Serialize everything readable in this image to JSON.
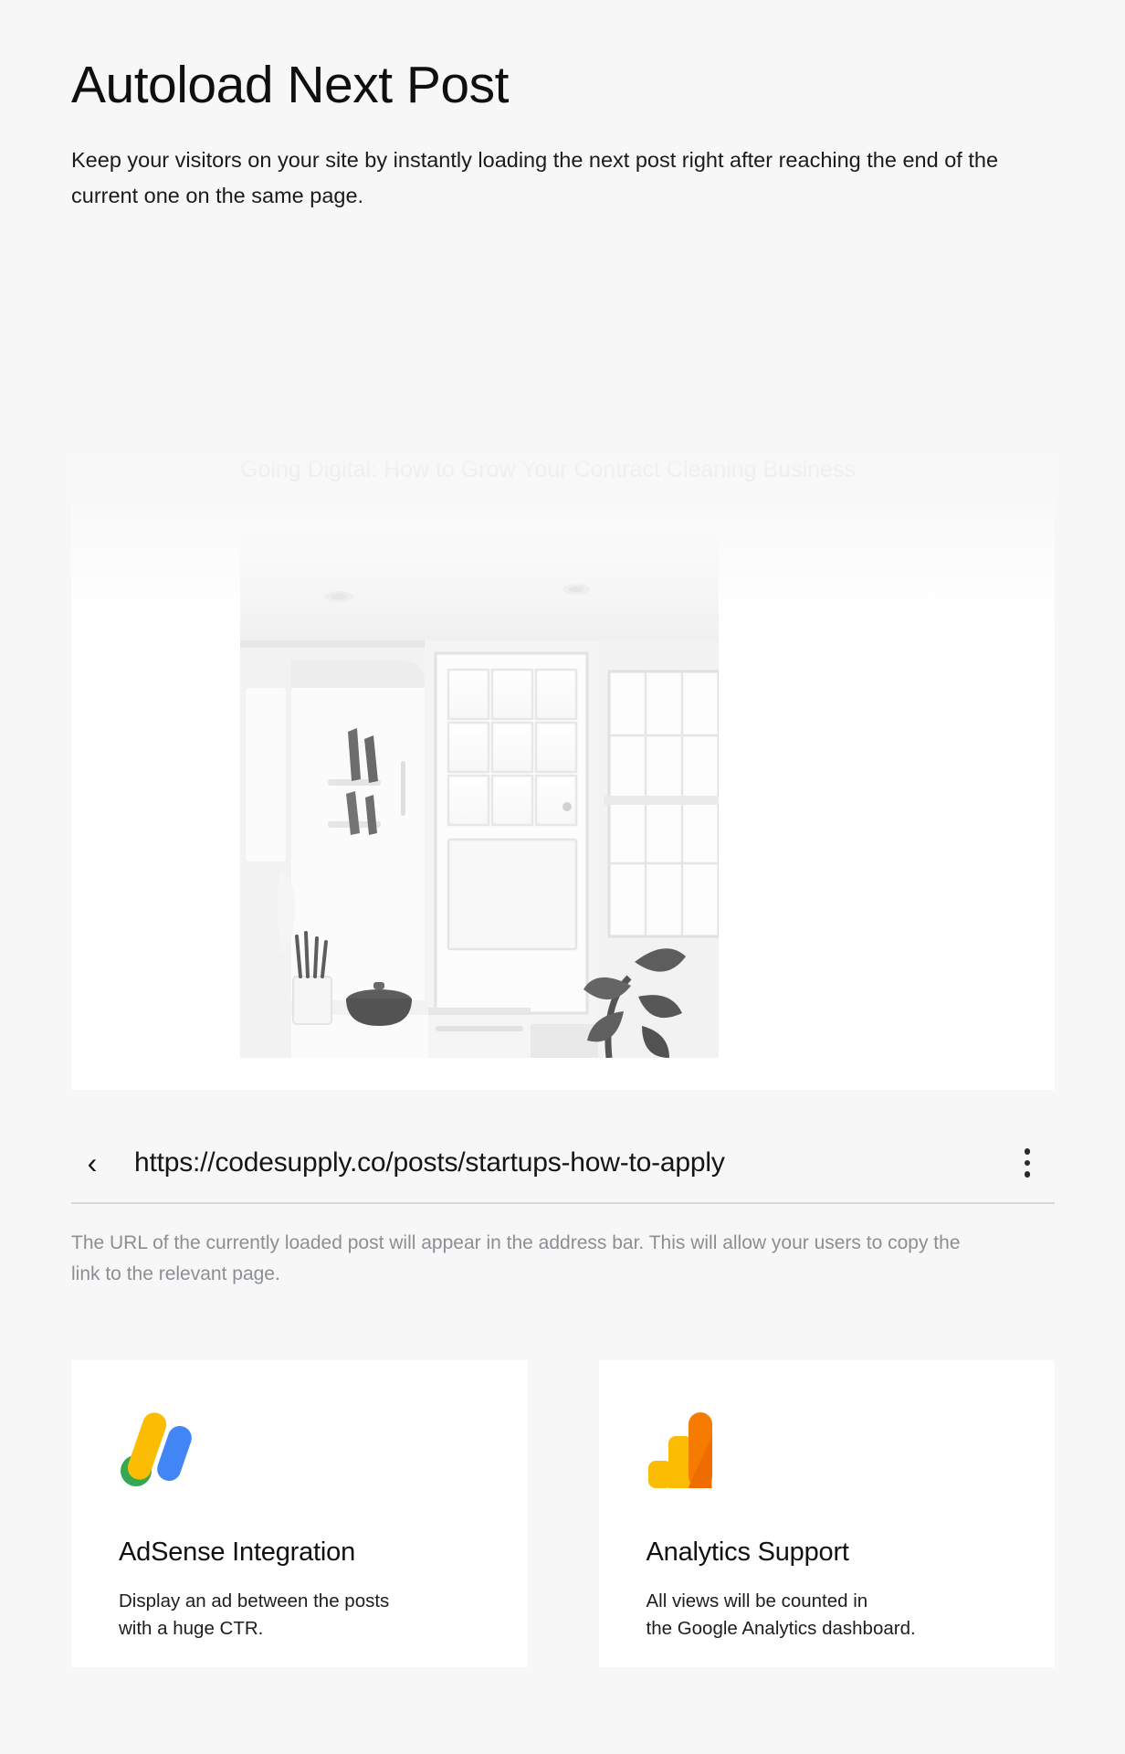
{
  "theme": {
    "page_background": "#f7f7f7",
    "card_background": "#ffffff",
    "title_color": "#0f0f0f",
    "muted_text_color": "#8b8f94",
    "divider_color": "#d4d7dc",
    "adsense_yellow": "#fbbc04",
    "adsense_green": "#34a853",
    "adsense_blue": "#4285f4",
    "analytics_orange": "#f57c00",
    "analytics_amber": "#fbbc04"
  },
  "header": {
    "title": "Autoload Next Post",
    "subtitle": "Keep your visitors on your site by instantly loading the next post right after reaching the end of the current one on the same page."
  },
  "preview": {
    "post_title": "Going Digital: How to Grow Your Contract Cleaning Business",
    "photo_alt": "black and white kitchen interior with door and window"
  },
  "address_bar": {
    "back_icon": "chevron-left-icon",
    "url": "https://codesupply.co/posts/startups-how-to-apply",
    "menu_icon": "kebab-menu-icon"
  },
  "caption": {
    "text": "The URL of the currently loaded post will appear in the address bar. This will allow your users to copy the link to the relevant page."
  },
  "cards": [
    {
      "icon": "google-adsense-icon",
      "title": "AdSense Integration",
      "description": "Display an ad between the posts\nwith a huge CTR."
    },
    {
      "icon": "google-analytics-icon",
      "title": "Analytics Support",
      "description": "All views will be counted in\nthe Google Analytics dashboard."
    }
  ]
}
